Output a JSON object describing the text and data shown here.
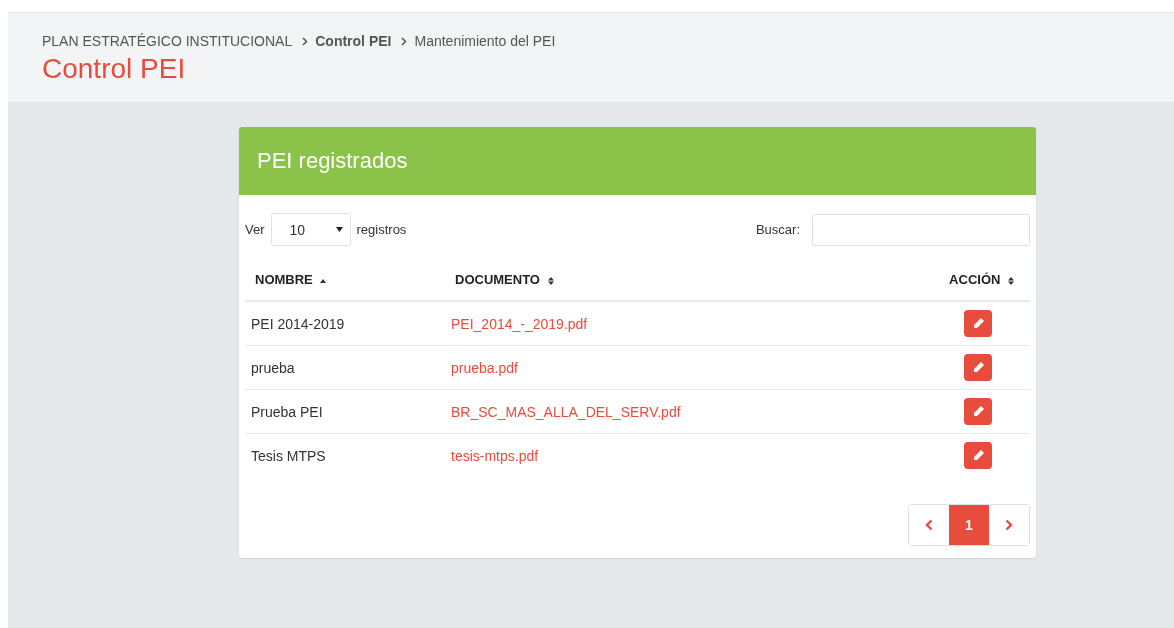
{
  "breadcrumb": [
    {
      "label": "PLAN ESTRATÉGICO INSTITUCIONAL",
      "bold": false
    },
    {
      "label": "Control PEI",
      "bold": true
    },
    {
      "label": "Mantenimiento del PEI",
      "bold": false
    }
  ],
  "page_title": "Control PEI",
  "panel": {
    "title": "PEI registrados",
    "length": {
      "prefix": "Ver",
      "value": "10",
      "suffix": "registros"
    },
    "search": {
      "label": "Buscar:"
    },
    "table": {
      "columns": [
        {
          "label": "NOMBRE",
          "sorted": true
        },
        {
          "label": "DOCUMENTO",
          "sorted": false
        },
        {
          "label": "ACCIÓN",
          "sorted": false
        }
      ],
      "rows": [
        {
          "name": "PEI 2014-2019",
          "document": "PEI_2014_-_2019.pdf"
        },
        {
          "name": "prueba",
          "document": "prueba.pdf"
        },
        {
          "name": "Prueba PEI",
          "document": "BR_SC_MAS_ALLA_DEL_SERV.pdf"
        },
        {
          "name": "Tesis MTPS",
          "document": "tesis-mtps.pdf"
        }
      ]
    },
    "pagination": {
      "pages": [
        {
          "label": "1",
          "selected": true
        }
      ]
    }
  }
}
